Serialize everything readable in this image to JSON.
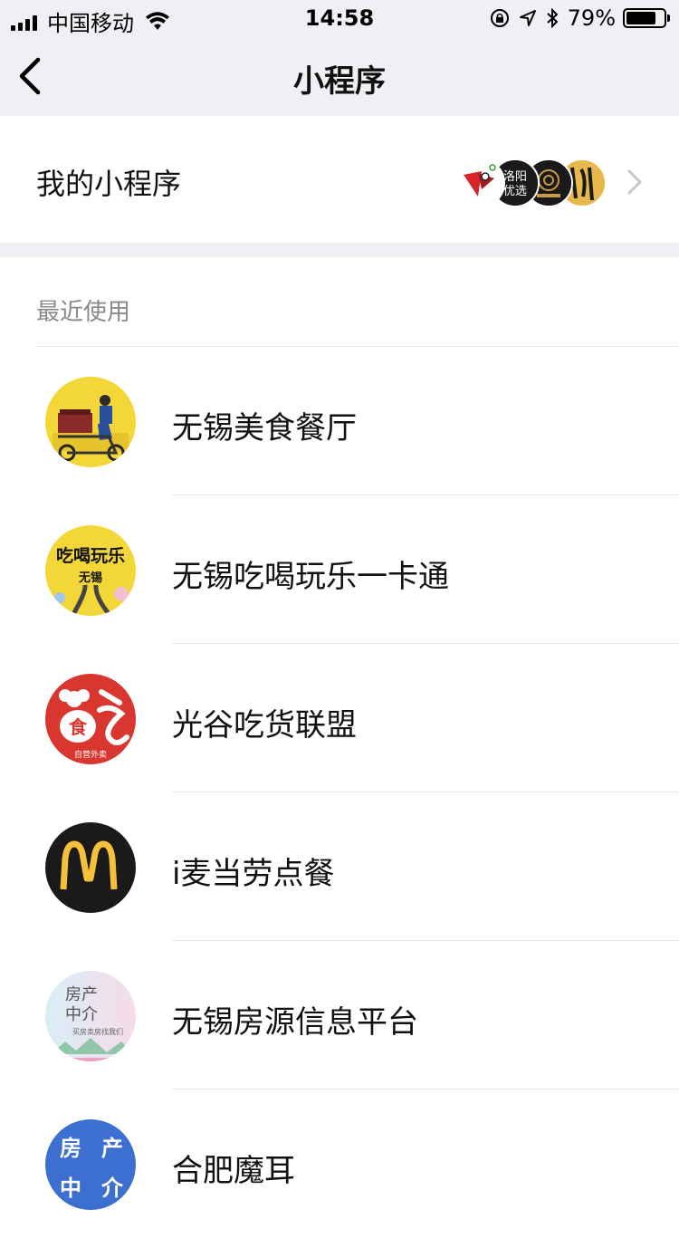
{
  "status_bar": {
    "carrier": "中国移动",
    "time": "14:58",
    "battery_percent": "79%",
    "battery_level": 0.79,
    "icons": [
      "signal-icon",
      "wifi-icon",
      "rotation-lock-icon",
      "location-icon",
      "bluetooth-icon",
      "battery-icon"
    ]
  },
  "nav": {
    "title": "小程序",
    "back_icon": "chevron-left-icon"
  },
  "my_programs": {
    "label": "我的小程序",
    "avatars": [
      {
        "name": "bird-logo",
        "color": "#d6262b"
      },
      {
        "name": "luoyang-youxuan",
        "text_line1": "洛阳",
        "text_line2": "优选",
        "color": "#1a1a1a"
      },
      {
        "name": "chinese-seal",
        "color": "#1a1a1a"
      },
      {
        "name": "calligraphy",
        "color": "#e8b84a"
      }
    ],
    "chevron_icon": "chevron-right-icon"
  },
  "recent": {
    "title": "最近使用",
    "items": [
      {
        "name": "无锡美食餐厅",
        "icon": "food-delivery-icon",
        "bg": "#f3d637"
      },
      {
        "name": "无锡吃喝玩乐一卡通",
        "icon": "chihe-wanle-icon",
        "bg": "#f3d637",
        "icon_text1": "吃喝玩乐",
        "icon_text2": "无锡"
      },
      {
        "name": "光谷吃货联盟",
        "icon": "chef-icon",
        "bg": "#d8362e",
        "icon_text1": "食",
        "icon_text2": "自营外卖"
      },
      {
        "name": "i麦当劳点餐",
        "icon": "mcdonalds-icon",
        "bg": "#1a1a1a"
      },
      {
        "name": "无锡房源信息平台",
        "icon": "house-agent-icon",
        "bg": "#f4e3ee",
        "icon_text1": "房产",
        "icon_text2": "中介",
        "icon_text3": "买房卖房找我们"
      },
      {
        "name": "合肥魔耳",
        "icon": "house-agency-blue-icon",
        "bg": "#3d6fd1",
        "icon_text1": "房",
        "icon_text2": "产",
        "icon_text3": "中",
        "icon_text4": "介"
      }
    ]
  }
}
